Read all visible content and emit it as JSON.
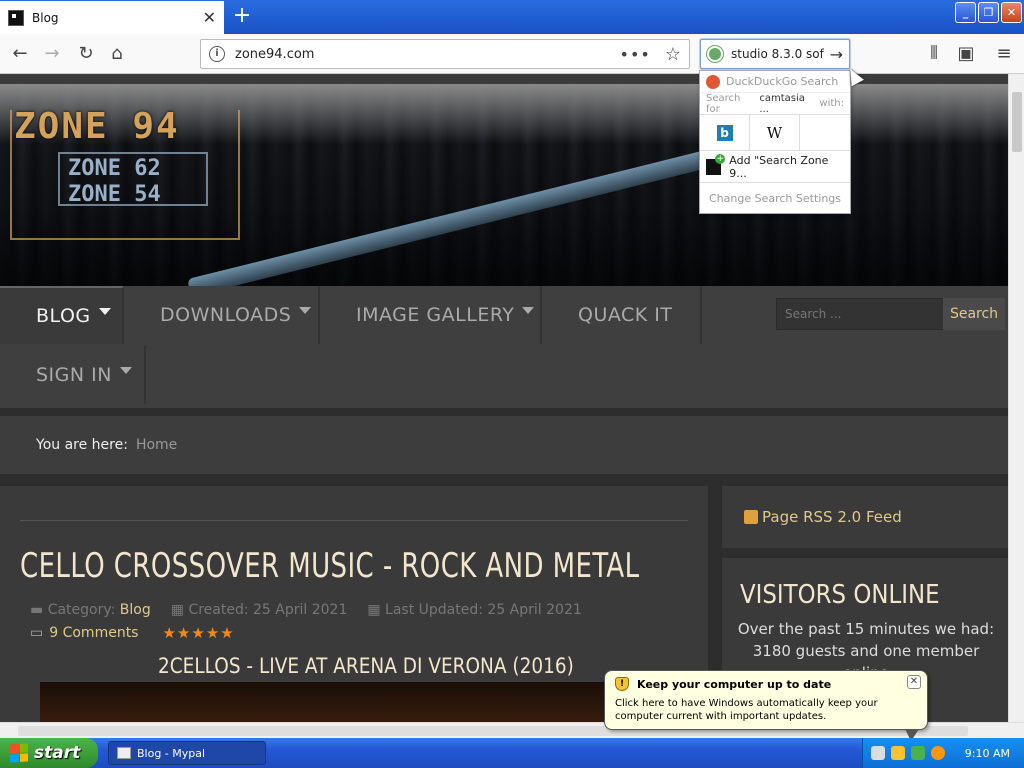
{
  "browser": {
    "tab_title": "Blog",
    "url": "zone94.com",
    "search_query": "studio 8.3.0 sof",
    "colors": {
      "tabbar": "#2a6de0",
      "accent": "#e0c98a"
    }
  },
  "search_dropdown": {
    "engine": "DuckDuckGo Search",
    "search_for_prefix": "Search for",
    "search_for_term": "camtasia ...",
    "search_for_suffix": "with:",
    "engine_icons": [
      "bing-icon",
      "wikipedia-icon"
    ],
    "bing_glyph": "b",
    "wiki_glyph": "W",
    "add_engine": "Add \"Search Zone 9...",
    "change_settings": "Change Search Settings"
  },
  "site": {
    "logo": {
      "main": "ZONE 94",
      "sub1": "ZONE 62",
      "sub2": "ZONE 54"
    },
    "menu": [
      {
        "label": "BLOG",
        "active": true,
        "caret": true
      },
      {
        "label": "DOWNLOADS",
        "active": false,
        "caret": true
      },
      {
        "label": "IMAGE GALLERY",
        "active": false,
        "caret": true
      },
      {
        "label": "QUACK IT",
        "active": false,
        "caret": false
      },
      {
        "label": "SIGN IN",
        "active": false,
        "caret": true
      }
    ],
    "search_placeholder": "Search ...",
    "search_button": "Search",
    "breadcrumb": {
      "prefix": "You are here:",
      "home": "Home"
    },
    "article": {
      "title": "CELLO CROSSOVER MUSIC - ROCK AND METAL",
      "category_label": "Category:",
      "category": "Blog",
      "created": "Created: 25 April 2021",
      "updated": "Last Updated: 25 April 2021",
      "comments": "9 Comments",
      "stars": "★★★★★",
      "subhead": "2CELLOS - LIVE AT ARENA DI VERONA (2016)"
    },
    "sidebar": {
      "rss": "Page RSS 2.0 Feed",
      "visitors_title": "VISITORS ONLINE",
      "visitors_text": "Over the past 15 minutes we had: 3180 guests and one member online"
    }
  },
  "balloon": {
    "title": "Keep your computer up to date",
    "text": "Click here to have Windows automatically keep your computer current with important updates."
  },
  "taskbar": {
    "start": "start",
    "task": "Blog - Mypal",
    "time": "9:10 AM"
  }
}
